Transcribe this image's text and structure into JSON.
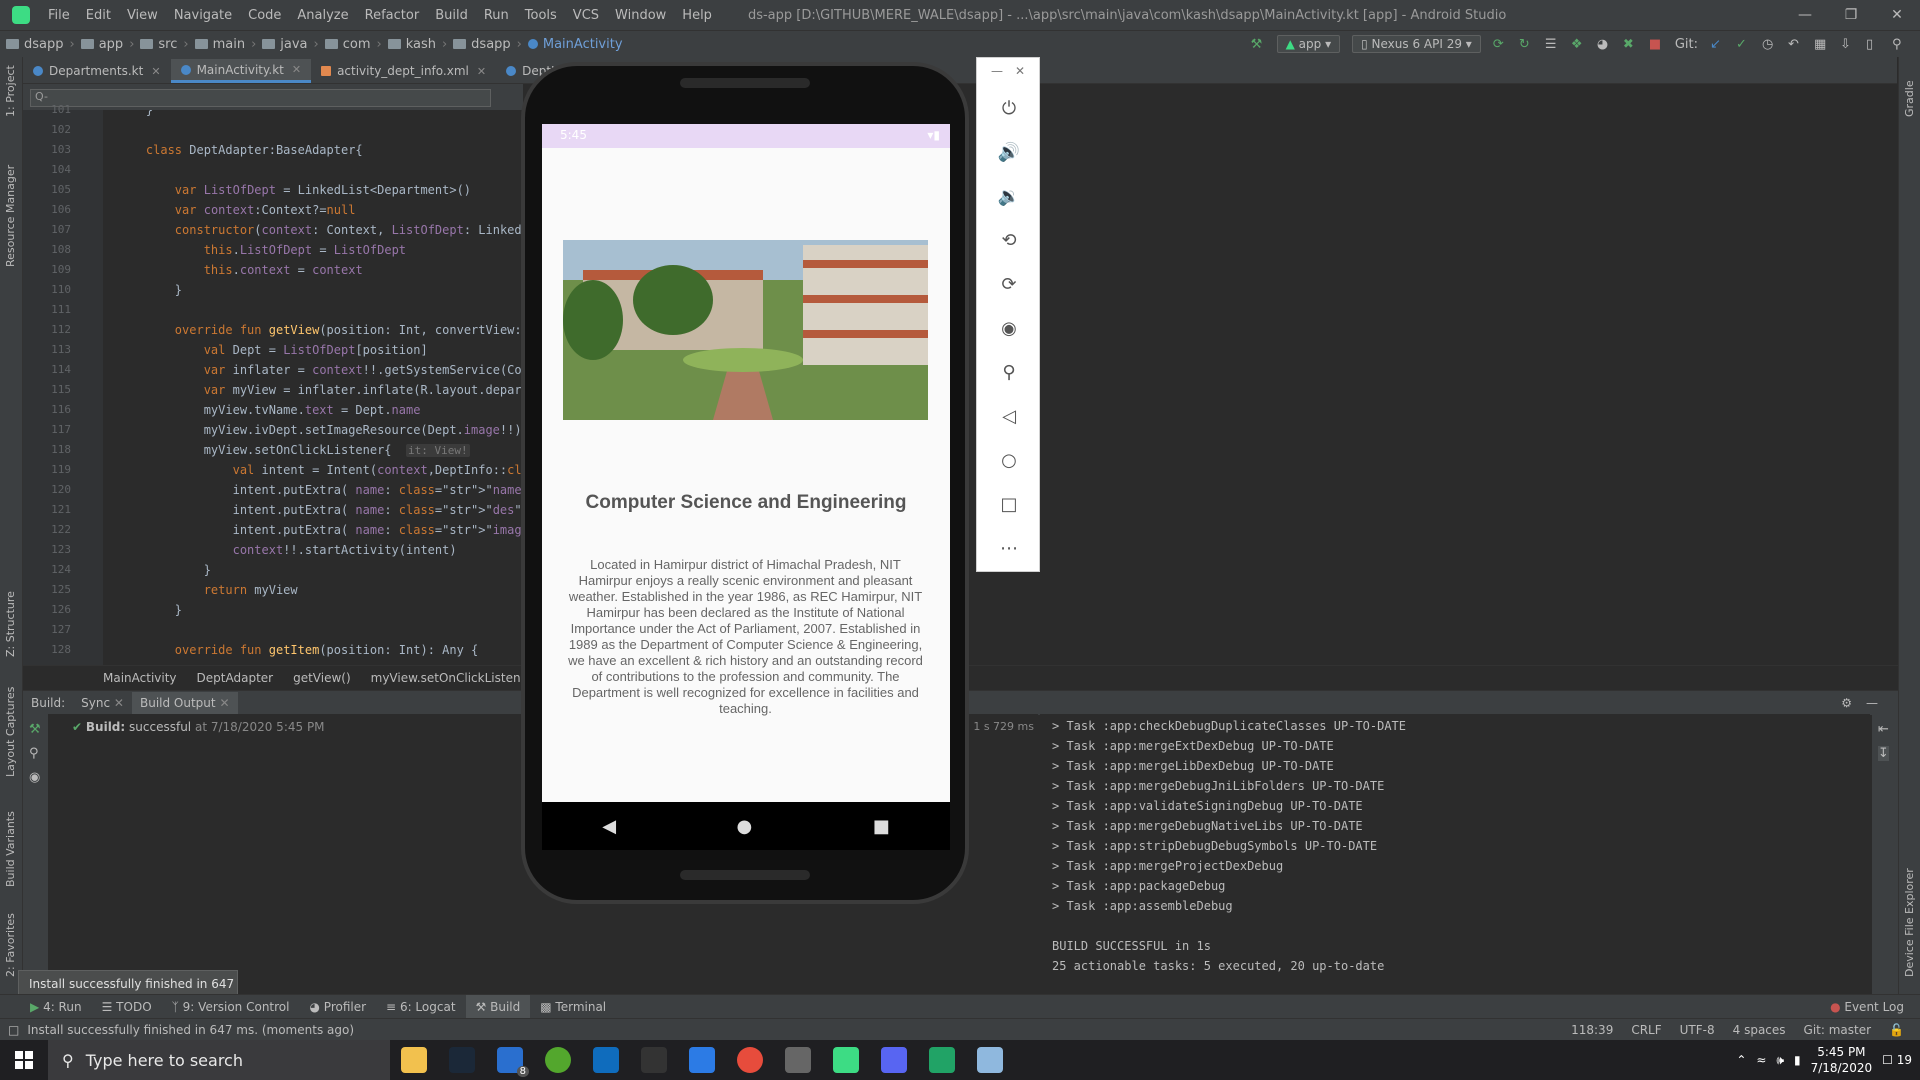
{
  "menubar": {
    "items": [
      "File",
      "Edit",
      "View",
      "Navigate",
      "Code",
      "Analyze",
      "Refactor",
      "Build",
      "Run",
      "Tools",
      "VCS",
      "Window",
      "Help"
    ],
    "title": "ds-app [D:\\GITHUB\\MERE_WALE\\dsapp] - ...\\app\\src\\main\\java\\com\\kash\\dsapp\\MainActivity.kt [app] - Android Studio"
  },
  "navbar": {
    "crumbs": [
      "dsapp",
      "app",
      "src",
      "main",
      "java",
      "com",
      "kash",
      "dsapp",
      "MainActivity"
    ],
    "run_config": "app",
    "device": "Nexus 6 API 29",
    "git_label": "Git:"
  },
  "tabs": [
    {
      "label": "Departments.kt",
      "type": "kt"
    },
    {
      "label": "MainActivity.kt",
      "type": "kt",
      "active": true
    },
    {
      "label": "activity_dept_info.xml",
      "type": "xml"
    },
    {
      "label": "DeptInfo.kt",
      "type": "kt"
    }
  ],
  "search": {
    "placeholder": "Q-"
  },
  "editor": {
    "lines": [
      {
        "n": "101",
        "code": "    }"
      },
      {
        "n": "102",
        "code": ""
      },
      {
        "n": "103",
        "code": "    class DeptAdapter:BaseAdapter{"
      },
      {
        "n": "104",
        "code": ""
      },
      {
        "n": "105",
        "code": "        var ListOfDept = LinkedList<Department>()"
      },
      {
        "n": "106",
        "code": "        var context:Context?=null"
      },
      {
        "n": "107",
        "code": "        constructor(context: Context, ListOfDept: LinkedList<D"
      },
      {
        "n": "108",
        "code": "            this.ListOfDept = ListOfDept"
      },
      {
        "n": "109",
        "code": "            this.context = context"
      },
      {
        "n": "110",
        "code": "        }"
      },
      {
        "n": "111",
        "code": ""
      },
      {
        "n": "112",
        "code": "        override fun getView(position: Int, convertView: View?"
      },
      {
        "n": "113",
        "code": "            val Dept = ListOfDept[position]"
      },
      {
        "n": "114",
        "code": "            var inflater = context!!.getSystemService(Context."
      },
      {
        "n": "115",
        "code": "            var myView = inflater.inflate(R.layout.department_"
      },
      {
        "n": "116",
        "code": "            myView.tvName.text = Dept.name"
      },
      {
        "n": "117",
        "code": "            myView.ivDept.setImageResource(Dept.image!!)"
      },
      {
        "n": "118",
        "code": "            myView.setOnClickListener{  it: View!"
      },
      {
        "n": "119",
        "code": "                val intent = Intent(context,DeptInfo::class.ja"
      },
      {
        "n": "120",
        "code": "                intent.putExtra( name: \"name\",Dept.name!!)"
      },
      {
        "n": "121",
        "code": "                intent.putExtra( name: \"des\",Dept.des!!)"
      },
      {
        "n": "122",
        "code": "                intent.putExtra( name: \"image\",Dept.image!!)"
      },
      {
        "n": "123",
        "code": "                context!!.startActivity(intent)"
      },
      {
        "n": "124",
        "code": "            }"
      },
      {
        "n": "125",
        "code": "            return myView"
      },
      {
        "n": "126",
        "code": "        }"
      },
      {
        "n": "127",
        "code": ""
      },
      {
        "n": "128",
        "code": "        override fun getItem(position: Int): Any {"
      }
    ]
  },
  "editor_crumbs": [
    "MainActivity",
    "DeptAdapter",
    "getView()",
    "myView.setOnClickListener{...}"
  ],
  "build": {
    "header_label": "Build:",
    "tabs": [
      "Sync",
      "Build Output"
    ],
    "status_label": "Build:",
    "status_text": "successful",
    "status_time": "at 7/18/2020 5:45 PM",
    "duration": "1 s 729 ms",
    "output": [
      "> Task :app:checkDebugDuplicateClasses UP-TO-DATE",
      "> Task :app:mergeExtDexDebug UP-TO-DATE",
      "> Task :app:mergeLibDexDebug UP-TO-DATE",
      "> Task :app:mergeDebugJniLibFolders UP-TO-DATE",
      "> Task :app:validateSigningDebug UP-TO-DATE",
      "> Task :app:mergeDebugNativeLibs UP-TO-DATE",
      "> Task :app:stripDebugDebugSymbols UP-TO-DATE",
      "> Task :app:mergeProjectDexDebug",
      "> Task :app:packageDebug",
      "> Task :app:assembleDebug",
      "",
      "BUILD SUCCESSFUL in 1s",
      "25 actionable tasks: 5 executed, 20 up-to-date"
    ]
  },
  "bottomtabs": [
    "4: Run",
    "TODO",
    "9: Version Control",
    "Profiler",
    "6: Logcat",
    "Build",
    "Terminal"
  ],
  "event_log": "Event Log",
  "toast": "Install successfully finished in 647 ms.",
  "statusbar": {
    "message": "Install successfully finished in 647 ms. (moments ago)",
    "position": "118:39",
    "line_sep": "CRLF",
    "encoding": "UTF-8",
    "indent": "4 spaces",
    "git": "Git: master"
  },
  "left_tools": [
    "1: Project",
    "Resource Manager",
    "Z: Structure",
    "Layout Captures",
    "Build Variants",
    "2: Favorites"
  ],
  "right_tools": [
    "Gradle",
    "Device File Explorer"
  ],
  "phone": {
    "time": "5:45",
    "dept_name": "Computer Science and Engineering",
    "dept_desc": "Located in Hamirpur district of Himachal Pradesh, NIT Hamirpur enjoys a really scenic environment and pleasant weather. Established in the year 1986, as REC Hamirpur, NIT Hamirpur has been declared as the Institute of National Importance under the Act of Parliament, 2007. Established in 1989 as the Department of Computer Science & Engineering, we have an excellent & rich history and an outstanding record of contributions to the profession and community. The Department is well recognized for excellence in facilities and teaching."
  },
  "taskbar": {
    "search_placeholder": "Type here to search",
    "time": "5:45 PM",
    "date": "7/18/2020",
    "notif_count": "19",
    "mail_badge": "8"
  }
}
